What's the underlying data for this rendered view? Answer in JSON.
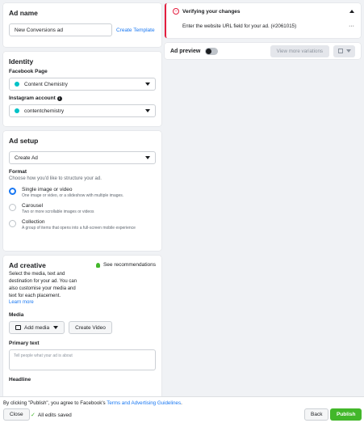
{
  "ad_name": {
    "title": "Ad name",
    "value": "New Conversions ad",
    "template_link": "Create Template"
  },
  "identity": {
    "title": "Identity",
    "fb_label": "Facebook Page",
    "fb_value": "Content Chemistry",
    "ig_label": "Instagram account",
    "ig_value": "contentchemistry"
  },
  "ad_setup": {
    "title": "Ad setup",
    "select_value": "Create Ad",
    "format_label": "Format",
    "format_desc": "Choose how you'd like to structure your ad.",
    "options": [
      {
        "title": "Single image or video",
        "desc": "One image or video, or a slideshow with multiple images."
      },
      {
        "title": "Carousel",
        "desc": "Two or more scrollable images or videos"
      },
      {
        "title": "Collection",
        "desc": "A group of items that opens into a full-screen mobile experience"
      }
    ]
  },
  "ad_creative": {
    "title": "Ad creative",
    "desc": "Select the media, text and destination for your ad. You can also customise your media and text for each placement.",
    "learn_more": "Learn more",
    "recs": "See recommendations",
    "media_label": "Media",
    "add_media": "Add media",
    "create_video": "Create Video",
    "primary_label": "Primary text",
    "primary_placeholder": "Tell people what your ad is about",
    "headline_label": "Headline"
  },
  "verify": {
    "title": "Verifying your changes",
    "message": "Enter the website URL field for your ad. (#2061015)",
    "more": "···"
  },
  "preview": {
    "label": "Ad preview",
    "variations": "View more variations"
  },
  "footer": {
    "notice_prefix": "By clicking \"Publish\", you agree to Facebook's ",
    "notice_link": "Terms and Advertising Guidelines",
    "notice_suffix": ".",
    "close": "Close",
    "saved": "All edits saved",
    "back": "Back",
    "publish": "Publish"
  }
}
